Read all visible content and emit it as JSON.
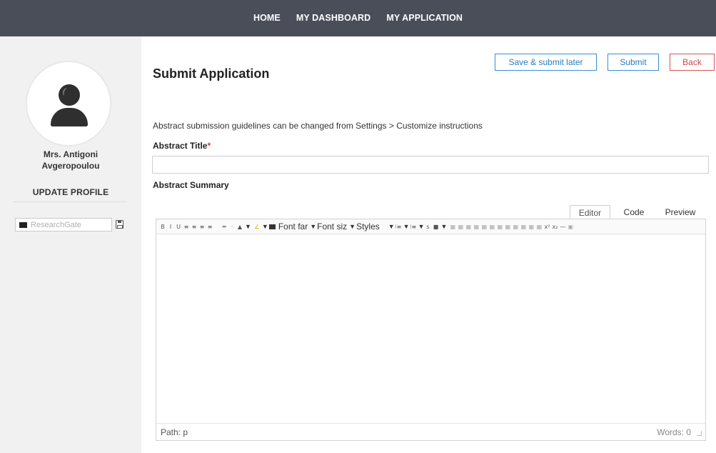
{
  "nav": {
    "items": [
      "HOME",
      "MY DASHBOARD",
      "MY APPLICATION"
    ]
  },
  "sidebar": {
    "user_name_line1": "Mrs. Antigoni",
    "user_name_line2": "Avgeropoulou",
    "update_profile": "UPDATE PROFILE",
    "researchgate_placeholder": "ResearchGate"
  },
  "main": {
    "title": "Submit Application",
    "buttons": {
      "save_later": "Save & submit later",
      "submit": "Submit",
      "back": "Back"
    },
    "guidelines": "Abstract submission guidelines can be changed from Settings > Customize instructions",
    "abstract_title_label": "Abstract Title",
    "required_mark": "*",
    "abstract_title_value": "",
    "abstract_summary_label": "Abstract Summary"
  },
  "editor": {
    "tabs": [
      "Editor",
      "Code",
      "Preview"
    ],
    "active_tab": "Editor",
    "toolbar": {
      "font_family": "Font far",
      "font_size": "Font siz",
      "styles": "Styles"
    },
    "path_label": "Path: p",
    "words_label": "Words: 0"
  },
  "colors": {
    "nav_bg": "#4a4e59",
    "sidebar_bg": "#f1f1f1",
    "primary_button": "#2a7cc0",
    "back_button": "#d04848",
    "required": "#dd3333"
  }
}
